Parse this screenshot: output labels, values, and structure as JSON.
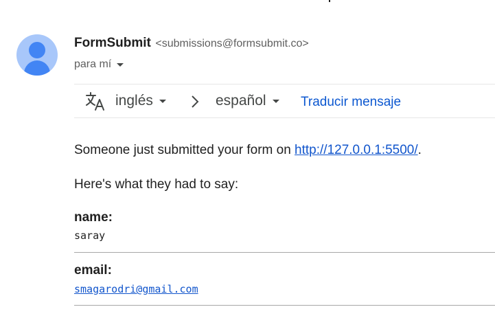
{
  "header": {
    "sender_name": "FormSubmit",
    "sender_email": "<submissions@formsubmit.co>",
    "recipient": "para mí"
  },
  "translate_bar": {
    "from_language": "inglés",
    "to_language": "español",
    "translate_label": "Traducir mensaje"
  },
  "message": {
    "intro_prefix": "Someone just submitted your form on ",
    "intro_link": "http://127.0.0.1:5500/",
    "intro_suffix": ".",
    "say_line": "Here's what they had to say:",
    "fields": [
      {
        "label": "name:",
        "value": "saray"
      },
      {
        "label": "email:",
        "value": "smagarodri@gmail.com"
      }
    ]
  },
  "colors": {
    "link": "#1155cc",
    "translate_link": "#0b57d0",
    "avatar_bg": "#a8c7fa",
    "avatar_fg": "#4285f4"
  },
  "icons": {
    "translate": "translate-icon",
    "arrow": "chevron-right-icon",
    "avatar": "person-avatar-icon"
  }
}
